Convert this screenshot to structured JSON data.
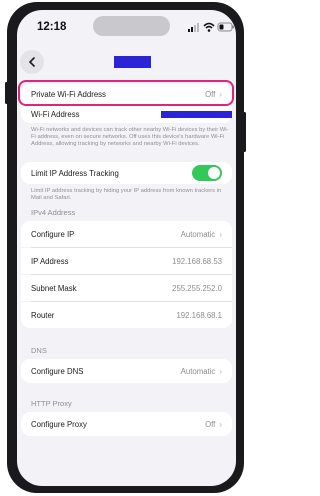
{
  "status_bar": {
    "time": "12:18"
  },
  "private_wifi": {
    "label": "Private Wi-Fi Address",
    "value": "Off"
  },
  "wifi_address": {
    "label": "Wi-Fi Address"
  },
  "wifi_footnote": "Wi-Fi networks and devices can track other nearby Wi-Fi devices by their Wi-Fi address, even on secure networks. Off uses this device's hardware Wi-Fi Address, allowing tracking by networks and nearby Wi-Fi devices.",
  "limit_ip": {
    "label": "Limit IP Address Tracking",
    "enabled": true
  },
  "limit_footnote": "Limit IP address tracking by hiding your IP address from known trackers in Mail and Safari.",
  "ipv4": {
    "header": "IPv4 Address",
    "configure_label": "Configure IP",
    "configure_value": "Automatic",
    "ip_label": "IP Address",
    "ip_value": "192.168.68.53",
    "subnet_label": "Subnet Mask",
    "subnet_value": "255.255.252.0",
    "router_label": "Router",
    "router_value": "192.168.68.1"
  },
  "dns": {
    "header": "DNS",
    "configure_label": "Configure DNS",
    "configure_value": "Automatic"
  },
  "proxy": {
    "header": "HTTP Proxy",
    "configure_label": "Configure Proxy",
    "configure_value": "Off"
  },
  "colors": {
    "accent_highlight": "#e0237f",
    "toggle_on": "#34c759",
    "redaction": "#2a24d6"
  }
}
